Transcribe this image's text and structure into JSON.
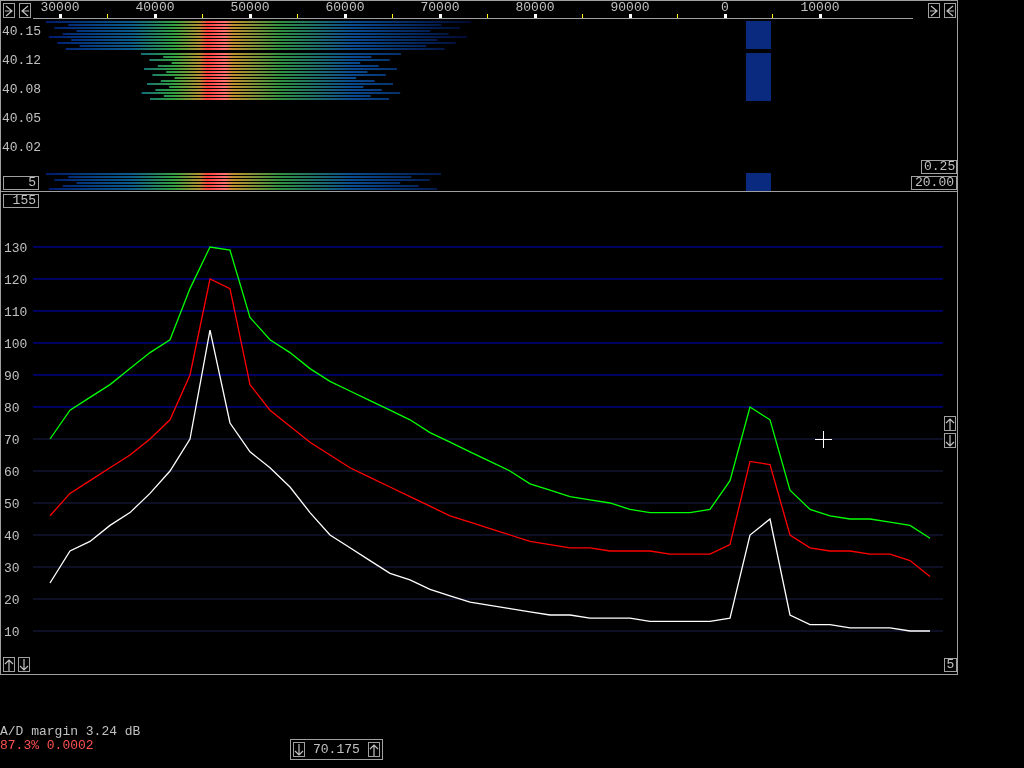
{
  "waterfall": {
    "freq_labels": [
      "30000",
      "40000",
      "50000",
      "60000",
      "70000",
      "80000",
      "90000",
      "0",
      "10000"
    ],
    "time_labels": [
      "40.15",
      "40.12",
      "40.08",
      "40.05",
      "40.02"
    ],
    "left_box": "5",
    "right_boxes": [
      "0.25",
      "20.00"
    ]
  },
  "spectrum": {
    "top_box": "155",
    "right_box": "5",
    "chart_data": {
      "type": "line",
      "grid": true,
      "ylim": [
        10,
        130
      ],
      "yticks": [
        10,
        20,
        30,
        40,
        50,
        60,
        70,
        80,
        90,
        100,
        110,
        120,
        130
      ],
      "series": [
        {
          "color": "#00ff00",
          "values": [
            70,
            79,
            83,
            87,
            92,
            97,
            101,
            117,
            130,
            129,
            108,
            101,
            97,
            92,
            88,
            85,
            82,
            79,
            76,
            72,
            69,
            66,
            63,
            60,
            56,
            54,
            52,
            51,
            50,
            48,
            47,
            47,
            47,
            48,
            57,
            80,
            76,
            54,
            48,
            46,
            45,
            45,
            44,
            43,
            39
          ]
        },
        {
          "color": "#ff0000",
          "values": [
            46,
            53,
            57,
            61,
            65,
            70,
            76,
            90,
            120,
            117,
            87,
            79,
            74,
            69,
            65,
            61,
            58,
            55,
            52,
            49,
            46,
            44,
            42,
            40,
            38,
            37,
            36,
            36,
            35,
            35,
            35,
            34,
            34,
            34,
            37,
            63,
            62,
            40,
            36,
            35,
            35,
            34,
            34,
            32,
            27
          ]
        },
        {
          "color": "#ffffff",
          "values": [
            25,
            35,
            38,
            43,
            47,
            53,
            60,
            70,
            104,
            75,
            66,
            61,
            55,
            47,
            40,
            36,
            32,
            28,
            26,
            23,
            21,
            19,
            18,
            17,
            16,
            15,
            15,
            14,
            14,
            14,
            13,
            13,
            13,
            13,
            14,
            40,
            45,
            15,
            12,
            12,
            11,
            11,
            11,
            10,
            10
          ]
        }
      ]
    }
  },
  "status": {
    "ad_margin": "A/D margin 3.24 dB",
    "overload": "87.3% 0.0002"
  },
  "frequency_box": {
    "value": "70.175"
  }
}
